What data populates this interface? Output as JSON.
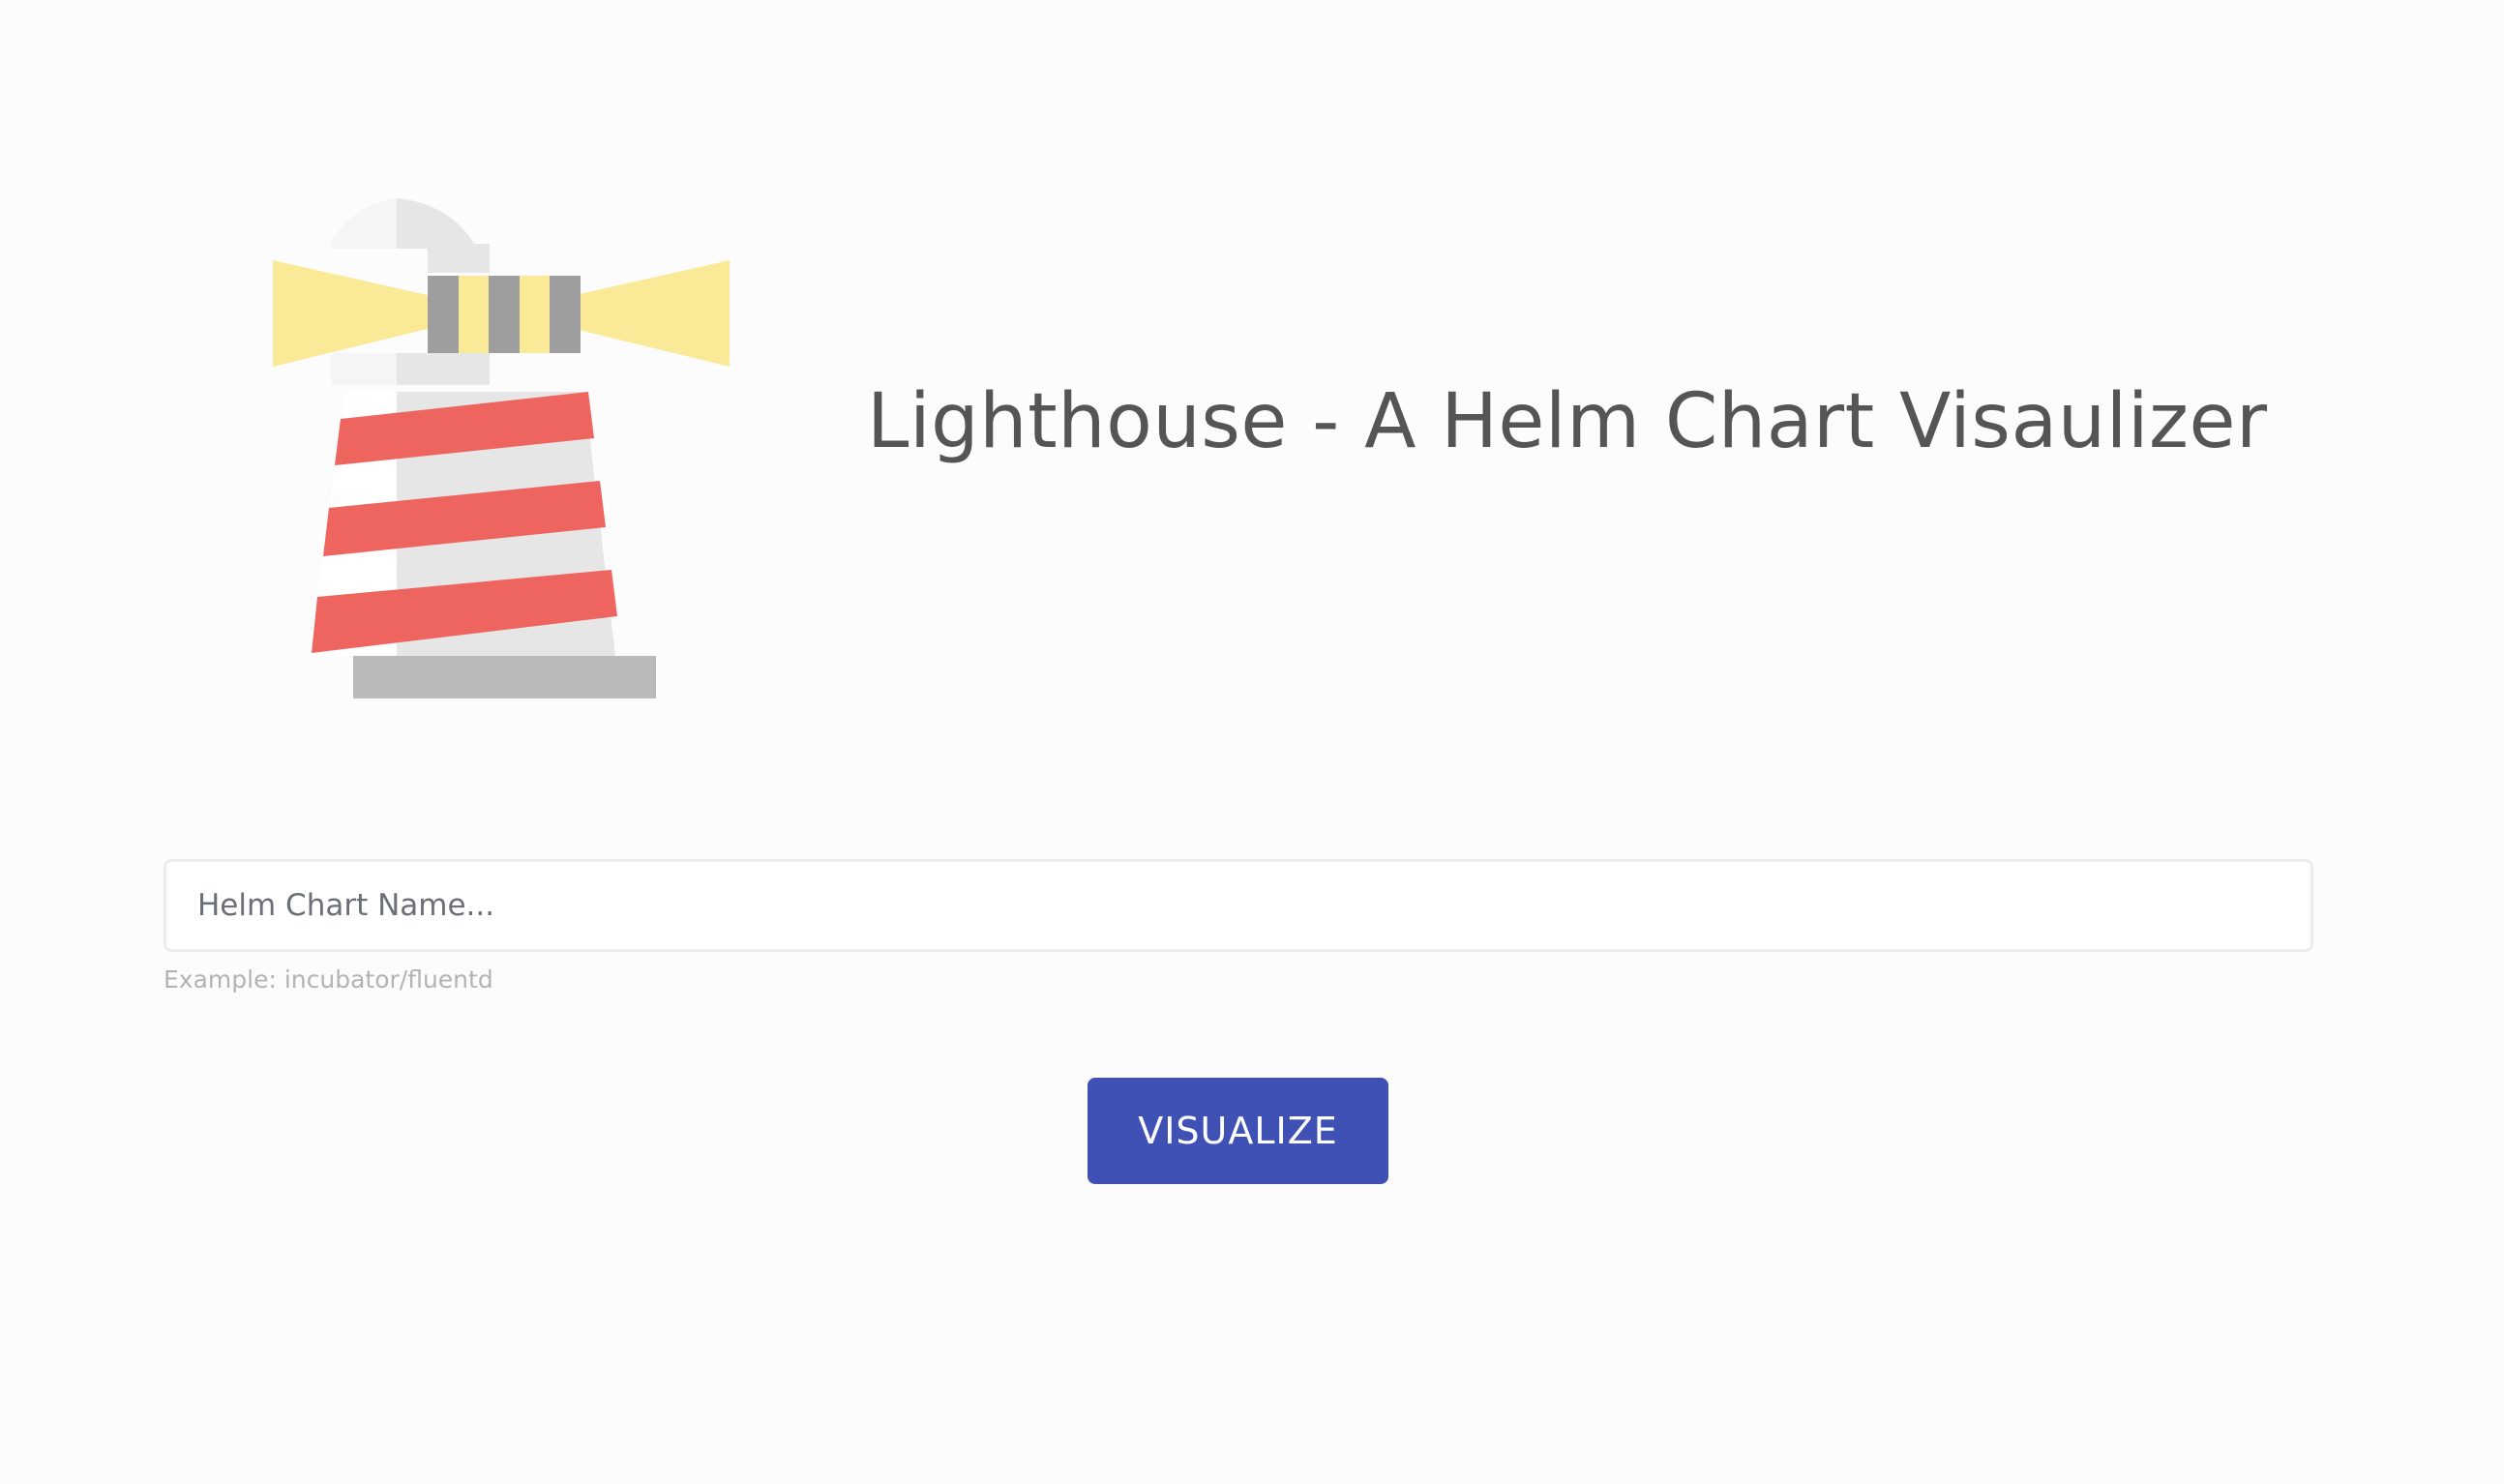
{
  "header": {
    "title": "Lighthouse - A Helm Chart Visaulizer",
    "logo_icon": "lighthouse-icon"
  },
  "search": {
    "value": "",
    "placeholder": "Helm Chart Name...",
    "helper_text": "Example: incubator/fluentd"
  },
  "actions": {
    "visualize_label": "VISUALIZE"
  },
  "colors": {
    "background": "#fcfcfc",
    "title_text": "#555555",
    "button_bg": "#3f51b5",
    "button_text": "#ffffff",
    "helper_text": "#b3b3b3",
    "lighthouse_red": "#ee645e",
    "lighthouse_light": "#fae996",
    "lighthouse_gray": "#e6e6e6",
    "lighthouse_dark_gray": "#9e9e9e",
    "lighthouse_base": "#bababa"
  }
}
